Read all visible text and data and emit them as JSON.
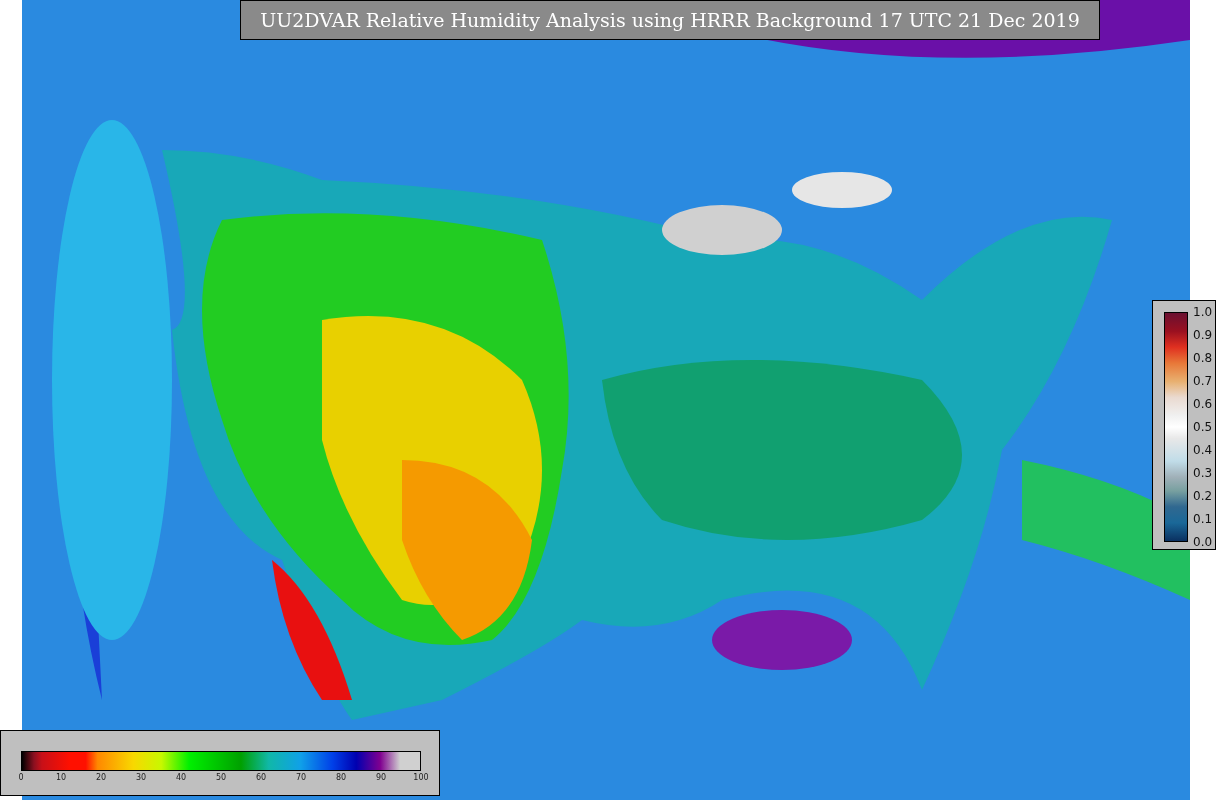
{
  "title": "UU2DVAR Relative Humidity Analysis using HRRR Background 17 UTC 21 Dec 2019",
  "humidity_legend": {
    "ticks": [
      "0",
      "10",
      "20",
      "30",
      "40",
      "50",
      "60",
      "70",
      "80",
      "90",
      "100"
    ]
  },
  "observation_legend": {
    "ticks": [
      "1.0",
      "0.9",
      "0.8",
      "0.7",
      "0.6",
      "0.5",
      "0.4",
      "0.3",
      "0.2",
      "0.1",
      "0.0"
    ]
  }
}
